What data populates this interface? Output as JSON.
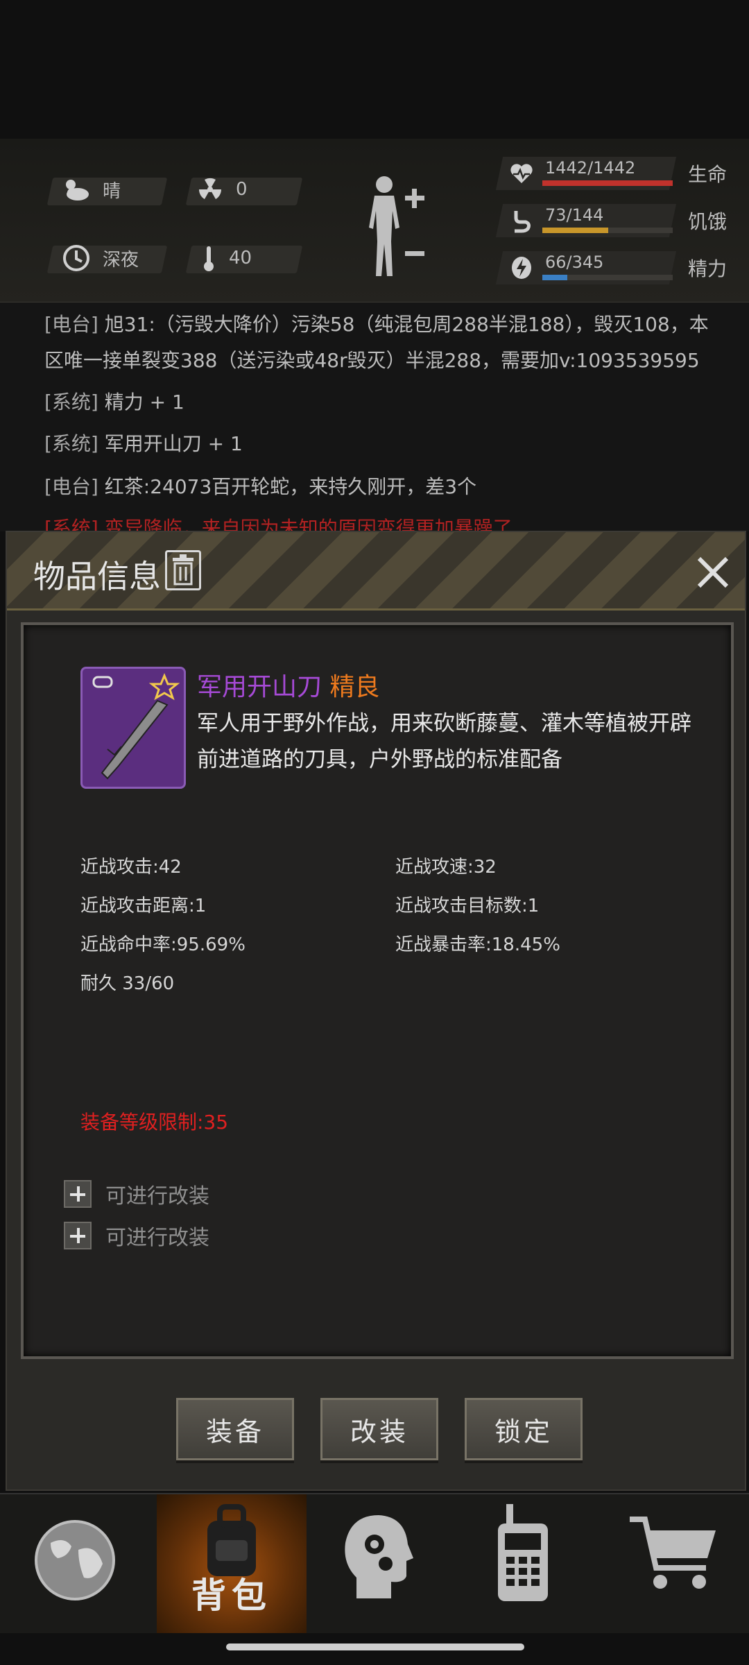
{
  "status": {
    "weather": {
      "icon": "cloudy-sun-icon",
      "label": "晴"
    },
    "radiation": {
      "icon": "radiation-icon",
      "value": "0"
    },
    "time": {
      "icon": "clock-icon",
      "label": "深夜"
    },
    "temperature": {
      "icon": "thermometer-icon",
      "value": "40"
    },
    "body_button": {
      "icon": "body-figure-icon"
    },
    "stats": [
      {
        "name": "生命",
        "value": "1442/1442",
        "fraction": 1.0,
        "color": "#c0322c",
        "icon": "heart-pulse-icon"
      },
      {
        "name": "饥饿",
        "value": "73/144",
        "fraction": 0.507,
        "color": "#c8962a",
        "icon": "stomach-icon"
      },
      {
        "name": "精力",
        "value": "66/345",
        "fraction": 0.191,
        "color": "#3a7fc4",
        "icon": "energy-icon"
      }
    ]
  },
  "log": [
    {
      "tag": "[电台]",
      "text": "旭31:（污毁大降价）污染58（纯混包周288半混188），毁灭108，本"
    },
    {
      "tag": "",
      "text": "区唯一接单裂变388（送污染或48r毁灭）半混288，需要加v:1093539595"
    },
    {
      "tag": "[系统]",
      "text": "精力 + 1"
    },
    {
      "tag": "[系统]",
      "text": "军用开山刀 + 1"
    },
    {
      "tag": "[电台]",
      "text": "红茶:24073百开轮蛇，来持久刚开，差3个"
    },
    {
      "tag": "[系统]",
      "text": "变异降临，来自因为未知的原因变得更加暴躁了"
    }
  ],
  "modal": {
    "title": "物品信息",
    "item": {
      "name": "军用开山刀",
      "quality": "精良",
      "description": "军人用于野外作战，用来砍断藤蔓、灌木等植被开辟前进道路的刀具，户外野战的标准配备"
    },
    "attributes": [
      "近战攻击:42",
      "近战攻速:32",
      "近战攻击距离:1",
      "近战攻击目标数:1",
      "近战命中率:95.69%",
      "近战暴击率:18.45%",
      "耐久 33/60"
    ],
    "level_limit": "装备等级限制:35",
    "mod_slots": [
      "可进行改装",
      "可进行改装"
    ],
    "buttons": {
      "equip": "装备",
      "modify": "改装",
      "lock": "锁定"
    }
  },
  "nav": [
    {
      "icon": "globe-icon",
      "label": ""
    },
    {
      "icon": "backpack-icon",
      "label": "背包",
      "active": true
    },
    {
      "icon": "head-gear-icon",
      "label": ""
    },
    {
      "icon": "radio-phone-icon",
      "label": ""
    },
    {
      "icon": "shopping-cart-icon",
      "label": ""
    }
  ]
}
